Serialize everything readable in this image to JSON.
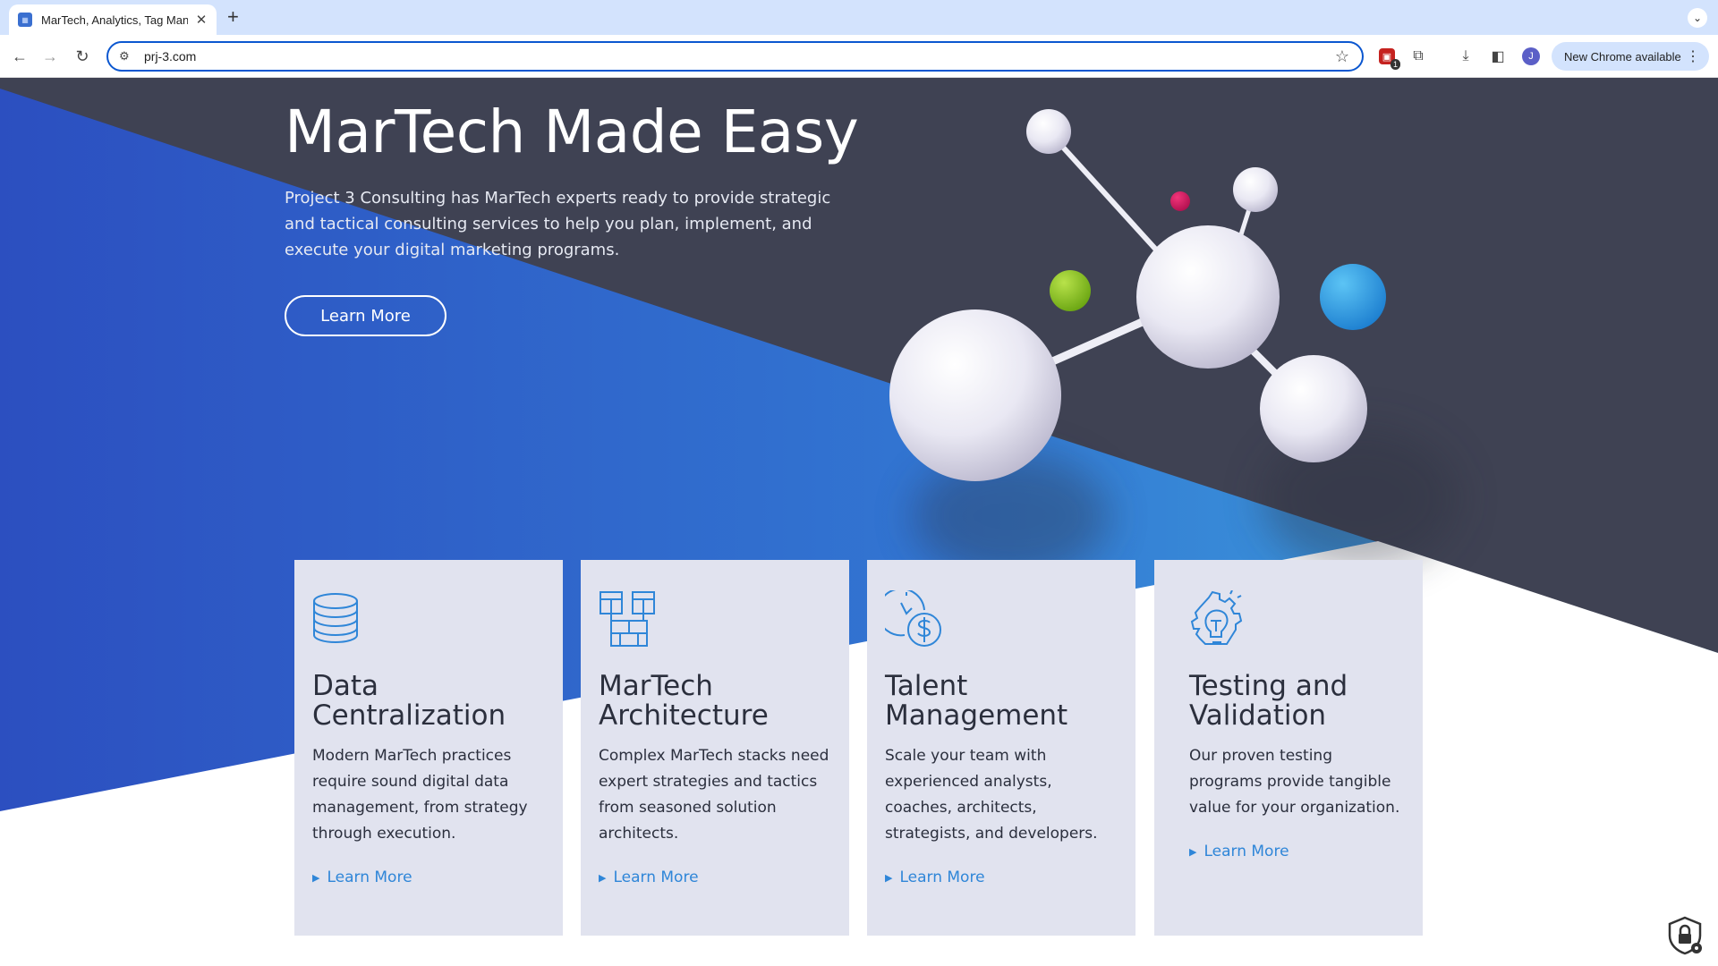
{
  "browser": {
    "tab_title": "MarTech, Analytics, Tag Mana",
    "url": "prj-3.com",
    "new_chrome_label": "New Chrome available",
    "avatar_letter": "J",
    "extension_badge": "1"
  },
  "hero": {
    "title": "MarTech Made Easy",
    "subtitle": "Project 3 Consulting has MarTech experts ready to provide strategic and tactical consulting services to help you plan, implement, and execute your digital marketing programs.",
    "button_label": "Learn More"
  },
  "cards": [
    {
      "title": "Data Centralization",
      "body": "Modern MarTech practices require sound digital data management, from strategy through execution.",
      "link": "Learn More",
      "icon": "database-icon"
    },
    {
      "title": "MarTech Architecture",
      "body": "Complex MarTech stacks need expert strategies and tactics from seasoned solution architects.",
      "link": "Learn More",
      "icon": "architecture-blocks-icon"
    },
    {
      "title": "Talent Management",
      "body": "Scale your team with experienced analysts, coaches, architects, strategists, and developers.",
      "link": "Learn More",
      "icon": "clock-dollar-icon"
    },
    {
      "title": "Testing and Validation",
      "body": "Our proven testing programs provide tangible value for your organization.",
      "link": "Learn More",
      "icon": "gear-lightbulb-icon"
    }
  ],
  "colors": {
    "dark_bg": "#3f4253",
    "blue_left": "#2c52c2",
    "blue_right": "#3fa3de",
    "card_bg": "#e1e3ef",
    "link_blue": "#2f86d8",
    "icon_blue": "#2f86d8"
  }
}
